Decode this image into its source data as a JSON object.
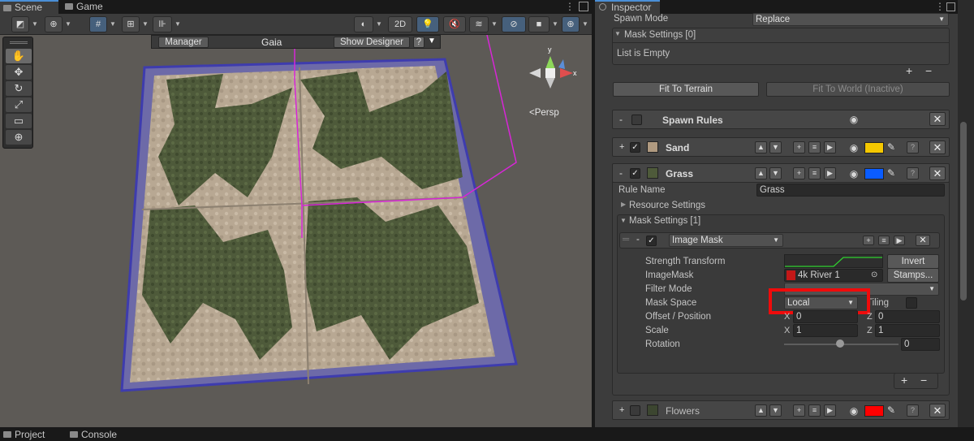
{
  "tabs": {
    "scene": "Scene",
    "game": "Game",
    "inspector": "Inspector"
  },
  "toolbar": {
    "mode_2d": "2D"
  },
  "gaia_bar": {
    "manager": "Manager",
    "title": "Gaia",
    "show_designer": "Show Designer",
    "help": "?"
  },
  "gizmo": {
    "persp": "<Persp",
    "axis_y": "y",
    "axis_x": "x"
  },
  "inspector": {
    "spawn_mode_label": "Spawn Mode",
    "spawn_mode_value": "Replace",
    "mask_settings_top": "Mask Settings [0]",
    "list_empty": "List is Empty",
    "fit_terrain": "Fit To Terrain",
    "fit_world": "Fit To World (Inactive)",
    "spawn_rules": "Spawn Rules",
    "rules": [
      {
        "name": "Sand",
        "color": "#f5c800"
      },
      {
        "name": "Grass",
        "color": "#0a5cff"
      },
      {
        "name": "Flowers",
        "color": "#ff0000"
      }
    ],
    "rule_name_label": "Rule Name",
    "rule_name_value": "Grass",
    "resource_settings": "Resource Settings",
    "mask_settings_1": "Mask Settings [1]",
    "mask_type": "Image Mask",
    "strength_transform": "Strength Transform",
    "invert": "Invert",
    "image_mask_label": "ImageMask",
    "image_mask_value": "4k River 1",
    "stamps": "Stamps...",
    "filter_mode": "Filter Mode",
    "mask_space": "Mask Space",
    "mask_space_value": "Local",
    "tiling": "Tiling",
    "offset_position": "Offset / Position",
    "scale": "Scale",
    "rotation": "Rotation",
    "x_label": "X",
    "z_label": "Z",
    "offset_x": "0",
    "offset_z": "0",
    "scale_x": "1",
    "scale_z": "1",
    "rotation_value": "0",
    "plus": "+",
    "minus": "−",
    "collapse": "-",
    "expand": "+"
  },
  "bottom_tabs": {
    "project": "Project",
    "console": "Console"
  }
}
